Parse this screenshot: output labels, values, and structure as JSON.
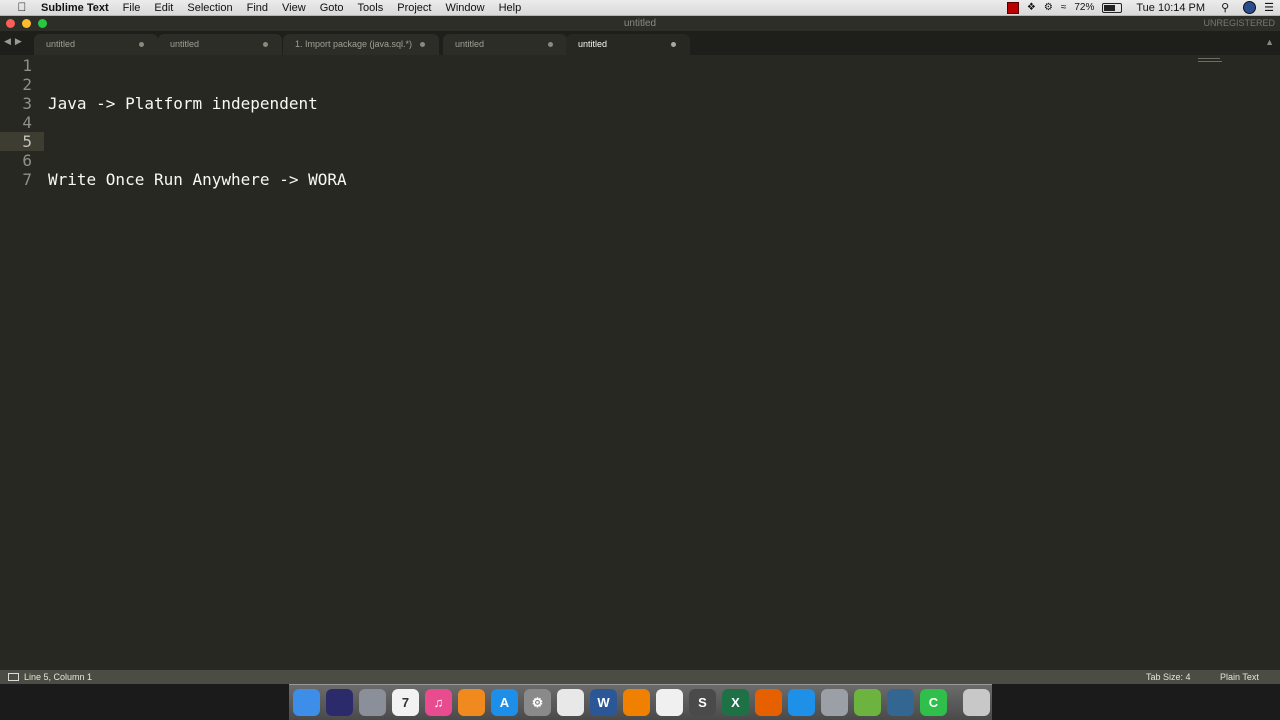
{
  "menubar": {
    "app_name": "Sublime Text",
    "items": [
      "File",
      "Edit",
      "Selection",
      "Find",
      "View",
      "Goto",
      "Tools",
      "Project",
      "Window",
      "Help"
    ],
    "battery": "72%",
    "clock": "Tue 10:14 PM"
  },
  "window": {
    "title": "untitled",
    "license": "UNREGISTERED"
  },
  "tabs": [
    {
      "label": "untitled",
      "active": false
    },
    {
      "label": "untitled",
      "active": false
    },
    {
      "label": "1. Import package (java.sql.*)",
      "active": false
    },
    {
      "label": "untitled",
      "active": false
    },
    {
      "label": "untitled",
      "active": true
    }
  ],
  "editor": {
    "current_line": 5,
    "lines": [
      {
        "num": "1",
        "text": ""
      },
      {
        "num": "2",
        "text": ""
      },
      {
        "num": "3",
        "text": "Java -> Platform independent"
      },
      {
        "num": "4",
        "text": ""
      },
      {
        "num": "5",
        "text": ""
      },
      {
        "num": "6",
        "text": ""
      },
      {
        "num": "7",
        "text": "Write Once Run Anywhere -> WORA"
      }
    ]
  },
  "statusbar": {
    "position": "Line 5, Column 1",
    "tab_size": "Tab Size: 4",
    "syntax": "Plain Text"
  },
  "dock": {
    "icons": [
      {
        "name": "finder",
        "color": "#3c8ee8",
        "glyph": ""
      },
      {
        "name": "siri",
        "color": "#2b2b6b",
        "glyph": ""
      },
      {
        "name": "launchpad",
        "color": "#8a8f99",
        "glyph": ""
      },
      {
        "name": "calendar",
        "color": "#f2f2f2",
        "glyph": "7"
      },
      {
        "name": "itunes",
        "color": "#e94b8f",
        "glyph": "♫"
      },
      {
        "name": "ibooks",
        "color": "#f08a1e",
        "glyph": ""
      },
      {
        "name": "app-store",
        "color": "#1e8fe8",
        "glyph": "A"
      },
      {
        "name": "system-preferences",
        "color": "#8a8a8a",
        "glyph": "⚙"
      },
      {
        "name": "chrome",
        "color": "#e8e8e8",
        "glyph": ""
      },
      {
        "name": "word",
        "color": "#2b5797",
        "glyph": "W"
      },
      {
        "name": "vlc",
        "color": "#f08000",
        "glyph": ""
      },
      {
        "name": "textedit",
        "color": "#f0f0f0",
        "glyph": ""
      },
      {
        "name": "sublime-text",
        "color": "#4a4a4a",
        "glyph": "S"
      },
      {
        "name": "excel",
        "color": "#1e7145",
        "glyph": "X"
      },
      {
        "name": "firefox",
        "color": "#e66000",
        "glyph": ""
      },
      {
        "name": "safari",
        "color": "#1e90e8",
        "glyph": ""
      },
      {
        "name": "preview",
        "color": "#9aa0a6",
        "glyph": ""
      },
      {
        "name": "spring-tool",
        "color": "#6db33f",
        "glyph": ""
      },
      {
        "name": "postgres",
        "color": "#336791",
        "glyph": ""
      },
      {
        "name": "camtasia",
        "color": "#2fbf4a",
        "glyph": "C"
      },
      {
        "name": "trash",
        "color": "#c8c8c8",
        "glyph": ""
      }
    ]
  }
}
